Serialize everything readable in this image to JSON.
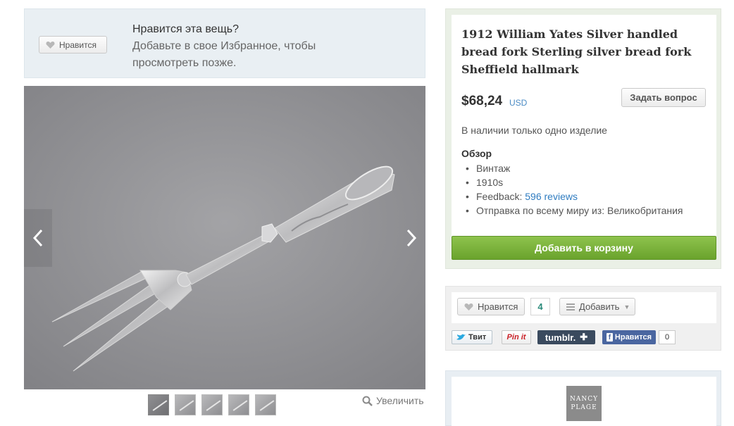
{
  "favorite_prompt": {
    "button_label": "Нравится",
    "title": "Нравится эта вещь?",
    "subtitle": "Добавьте в свое Избранное, чтобы просмотреть позже."
  },
  "gallery": {
    "zoom_label": "Увеличить",
    "prev_icon": "chevron-left-icon",
    "next_icon": "chevron-right-icon",
    "thumbnail_count": 5
  },
  "listing": {
    "title": "1912 William Yates Silver handled bread fork Sterling silver bread fork Sheffield hallmark",
    "price": "$68,24",
    "currency": "USD",
    "ask_button": "Задать вопрос",
    "stock": "В наличии только одно изделие",
    "overview_heading": "Обзор",
    "overview": {
      "item1": "Винтаж",
      "item2": "1910s",
      "feedback_prefix": "Feedback:",
      "feedback_link": "596 reviews",
      "shipping": "Отправка по всему миру из: Великобритания"
    },
    "cart_button": "Добавить в корзину"
  },
  "social": {
    "like_label": "Нравится",
    "like_count": "4",
    "add_label": "Добавить",
    "tweet_label": "Твит",
    "pin_label": "Pin it",
    "tumblr_label": "tumblr.",
    "fb_label": "Нравится",
    "fb_count": "0"
  },
  "shop": {
    "logo_line1": "NANCY",
    "logo_line2": "PLAGE"
  },
  "colors": {
    "cart_green": "#7bb33d",
    "link_blue": "#2f7cc0",
    "banner_bg": "#e9eff3"
  }
}
